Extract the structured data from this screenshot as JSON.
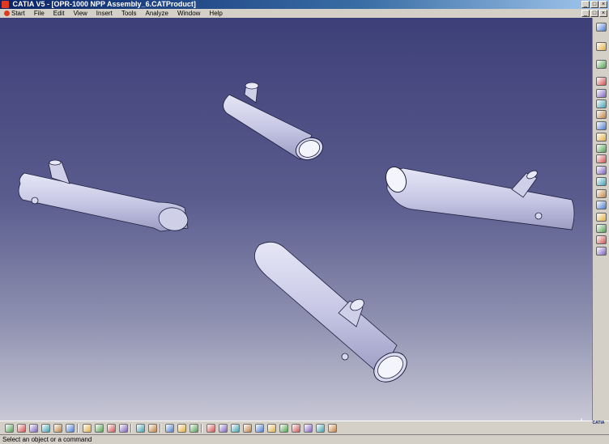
{
  "window": {
    "title": "CATIA V5 - [OPR-1000 NPP Assembly_6.CATProduct]",
    "minimize_label": "_",
    "maximize_label": "□",
    "close_label": "×"
  },
  "menu": {
    "items": [
      "Start",
      "File",
      "Edit",
      "View",
      "Insert",
      "Tools",
      "Analyze",
      "Window",
      "Help"
    ]
  },
  "status": {
    "message": "Select an object or a command"
  },
  "logo": {
    "text": "CATIA"
  },
  "colors": {
    "title_bar": "#0a246a",
    "viewport_top": "#3d3f78",
    "viewport_bottom": "#c8c8d6",
    "pipe_fill": "#c8c8e6"
  },
  "icons": {
    "right_toolbar": [
      "sketch-icon",
      "select-icon",
      "product-icon",
      "insert-component-icon",
      "existing-component-icon",
      "manipulate-icon",
      "snap-icon",
      "explode-icon",
      "constraint-icon",
      "fix-icon",
      "contact-icon",
      "offset-icon",
      "angle-icon",
      "update-icon",
      "clash-icon",
      "section-icon",
      "distance-icon",
      "bulb-icon",
      "cross-icon"
    ],
    "bottom_toolbar": [
      "new-icon",
      "open-icon",
      "save-icon",
      "print-icon",
      "cut-icon",
      "copy-icon",
      "paste-icon",
      "undo-icon",
      "redo-icon",
      "whats-this-icon",
      "formula-icon",
      "sketcher-icon",
      "hide-show-icon",
      "swap-icon",
      "fly-icon",
      "fit-all-icon",
      "pan-icon",
      "rotate-icon",
      "zoom-in-icon",
      "zoom-out-icon",
      "normal-view-icon",
      "iso-view-icon",
      "render-style-icon",
      "shading-icon",
      "hide-icon",
      "swap-visible-icon"
    ]
  }
}
